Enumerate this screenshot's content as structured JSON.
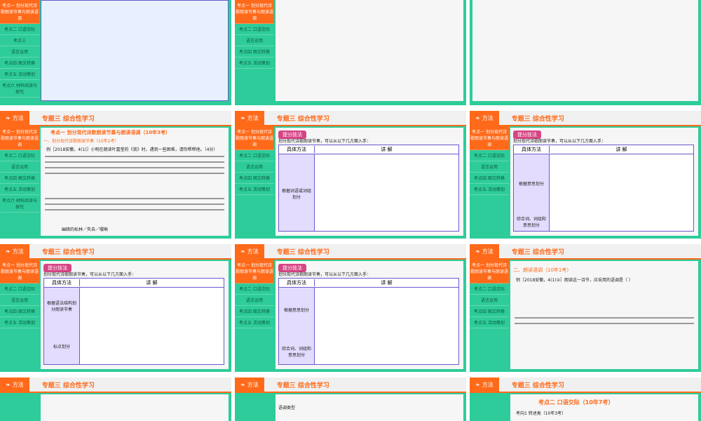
{
  "slides": {
    "header_tag": "方法",
    "header_title": "专题三 综合性学习",
    "sidebar": [
      "考点一 划分现代诗歌朗读节奏与朗读语调",
      "考点二 口语交际",
      "考点三",
      "语言运用",
      "考点四 图文转换",
      "考点五 活动策划",
      "考点六 材料阅读与探究",
      "考点七 仿写、补写与拟写"
    ]
  },
  "row2": {
    "a_title": "考点一 划分现代诗歌朗读节奏与朗读语调（10年3考）",
    "a_sub": "一、划分现代诗歌朗读节奏（10年2考）",
    "a_example": "例［2018安徽，4(1)］小明在朗读叶嘉莹的《我》时，遇到一些困难，请你帮帮他。（4分）",
    "a_answer": "幽暗的松林／失去／嘤啾",
    "b_badge": "提分技法",
    "b_intro": "划分现代诗歌朗读节奏，可以从以下几方面入手：",
    "b_col1": "具体方法",
    "b_col2": "讲 解",
    "b_row1": "根据词语或词组划分",
    "c_row1": "根据意思划分",
    "c_row2": "综合词、词组和意思划分"
  },
  "row3": {
    "a_row1": "根据语法结构划分朗读节奏",
    "a_row2": "标点划分",
    "c_title": "二、朗读语调（10年1考）",
    "c_example": "例［2018安徽，4(1)②］朗读这一诗节，应采用的语调是（ ）"
  },
  "row4": {
    "b_type": "语调类型",
    "c_title": "考点二 口语交际（10年7考）",
    "c_sub": "考向1 转述类（10年3考）"
  }
}
